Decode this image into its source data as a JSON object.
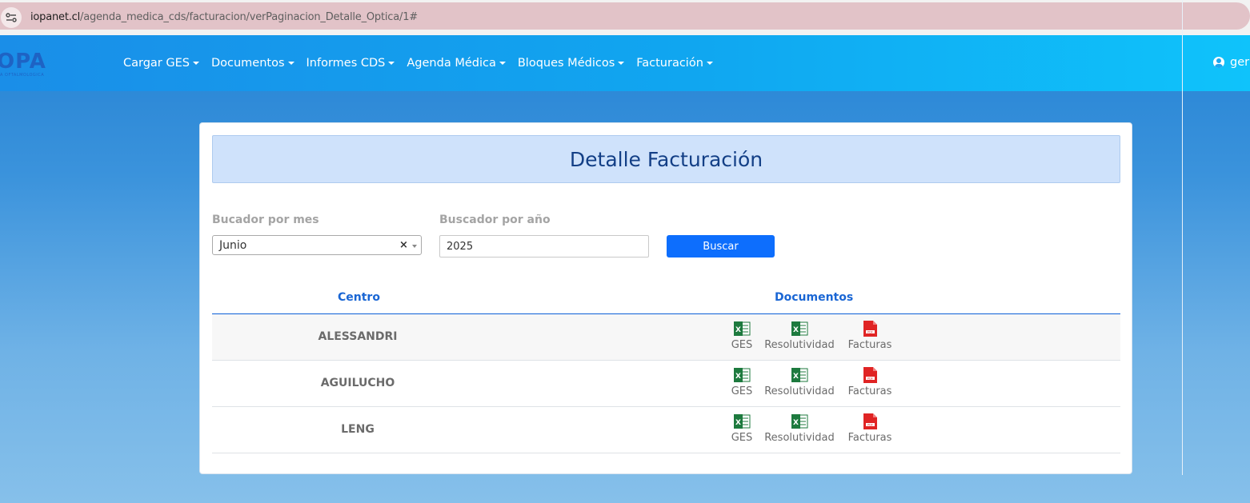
{
  "browser": {
    "url_host": "iopanet.cl",
    "url_path": "/agenda_medica_cds/facturacion/verPaginacion_Detalle_Optica/1#"
  },
  "navbar": {
    "logo_text": "OPA",
    "logo_subtext": "A OFTALMOLOGICA",
    "menu": [
      {
        "label": "Cargar GES"
      },
      {
        "label": "Documentos"
      },
      {
        "label": "Informes CDS"
      },
      {
        "label": "Agenda Médica"
      },
      {
        "label": "Bloques Médicos"
      },
      {
        "label": "Facturación"
      }
    ],
    "user_label": "ger"
  },
  "page": {
    "title": "Detalle Facturación",
    "month_label": "Bucador por mes",
    "month_value": "Junio",
    "year_label": "Buscador por año",
    "year_value": "2025",
    "search_button": "Buscar"
  },
  "table": {
    "headers": {
      "centro": "Centro",
      "documentos": "Documentos"
    },
    "doc_labels": {
      "ges": "GES",
      "resolutividad": "Resolutividad",
      "facturas": "Facturas"
    },
    "rows": [
      {
        "centro": "ALESSANDRI"
      },
      {
        "centro": "AGUILUCHO"
      },
      {
        "centro": "LENG"
      }
    ]
  },
  "icons": {
    "excel": "excel-file-icon",
    "pdf": "pdf-file-icon",
    "colors": {
      "excel": "#1d7a3e",
      "pdf": "#e02424",
      "primary": "#0d6efd",
      "title": "#133f86"
    }
  }
}
